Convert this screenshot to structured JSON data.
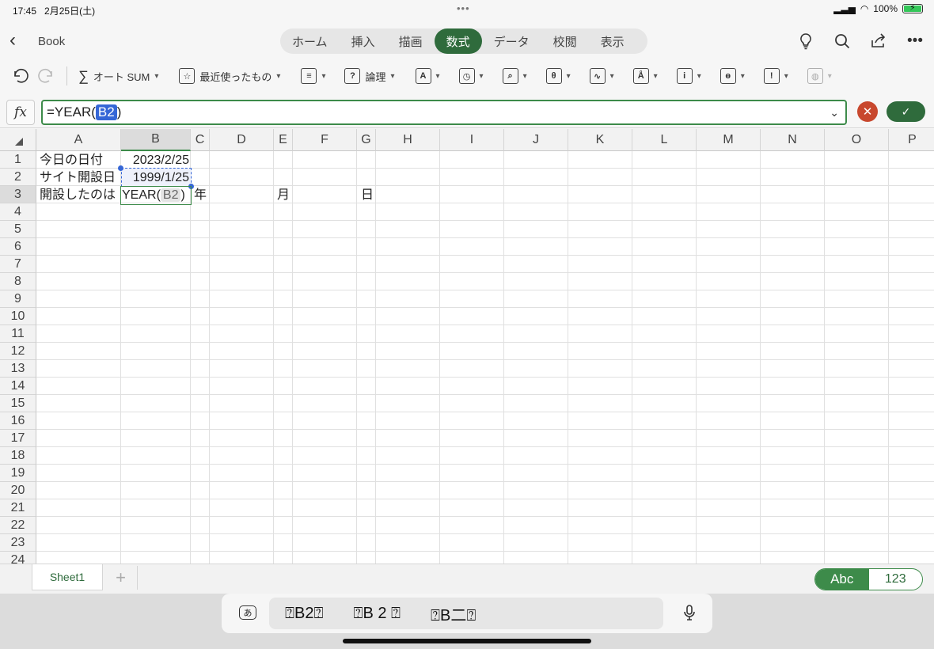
{
  "status": {
    "time": "17:45",
    "date": "2月25日(土)",
    "dots": "•••",
    "battery": "100%"
  },
  "title": {
    "back": "‹",
    "book": "Book"
  },
  "tabs": [
    {
      "label": "ホーム"
    },
    {
      "label": "挿入"
    },
    {
      "label": "描画"
    },
    {
      "label": "数式"
    },
    {
      "label": "データ"
    },
    {
      "label": "校閲"
    },
    {
      "label": "表示"
    }
  ],
  "ribbon": {
    "autosum": "オート SUM",
    "recent": "最近使ったもの",
    "logic": "論理"
  },
  "formula": {
    "prefix": "=YEAR(",
    "ref": "B2",
    "suffix": ")"
  },
  "columns": [
    "A",
    "B",
    "C",
    "D",
    "E",
    "F",
    "G",
    "H",
    "I",
    "J",
    "K",
    "L",
    "M",
    "N",
    "O",
    "P"
  ],
  "rows": [
    "1",
    "2",
    "3",
    "4",
    "5",
    "6",
    "7",
    "8",
    "9",
    "10",
    "11",
    "12",
    "13",
    "14",
    "15",
    "16",
    "17",
    "18",
    "19",
    "20",
    "21",
    "22",
    "23",
    "24"
  ],
  "cells": {
    "A1": "今日の日付",
    "B1": "2023/2/25",
    "A2": "サイト開設日",
    "B2": "1999/1/25",
    "A3": "開設したのは",
    "B3_prefix": "YEAR(",
    "B3_ref": "B2",
    "B3_suffix": ")",
    "C3": "年",
    "E3": "月",
    "G3": "日"
  },
  "sheets": {
    "tab": "Sheet1",
    "add": "+"
  },
  "mode": {
    "abc": "Abc",
    "num": "123"
  },
  "keyboard": {
    "kana": "あ",
    "s1": "⍰B2⍰",
    "s2": "⍰B 2 ⍰",
    "s3": "⍰B二⍰"
  },
  "colors": {
    "accent": "#2f6b3c",
    "ref_blue": "#3566d6",
    "cancel": "#c8482e"
  }
}
